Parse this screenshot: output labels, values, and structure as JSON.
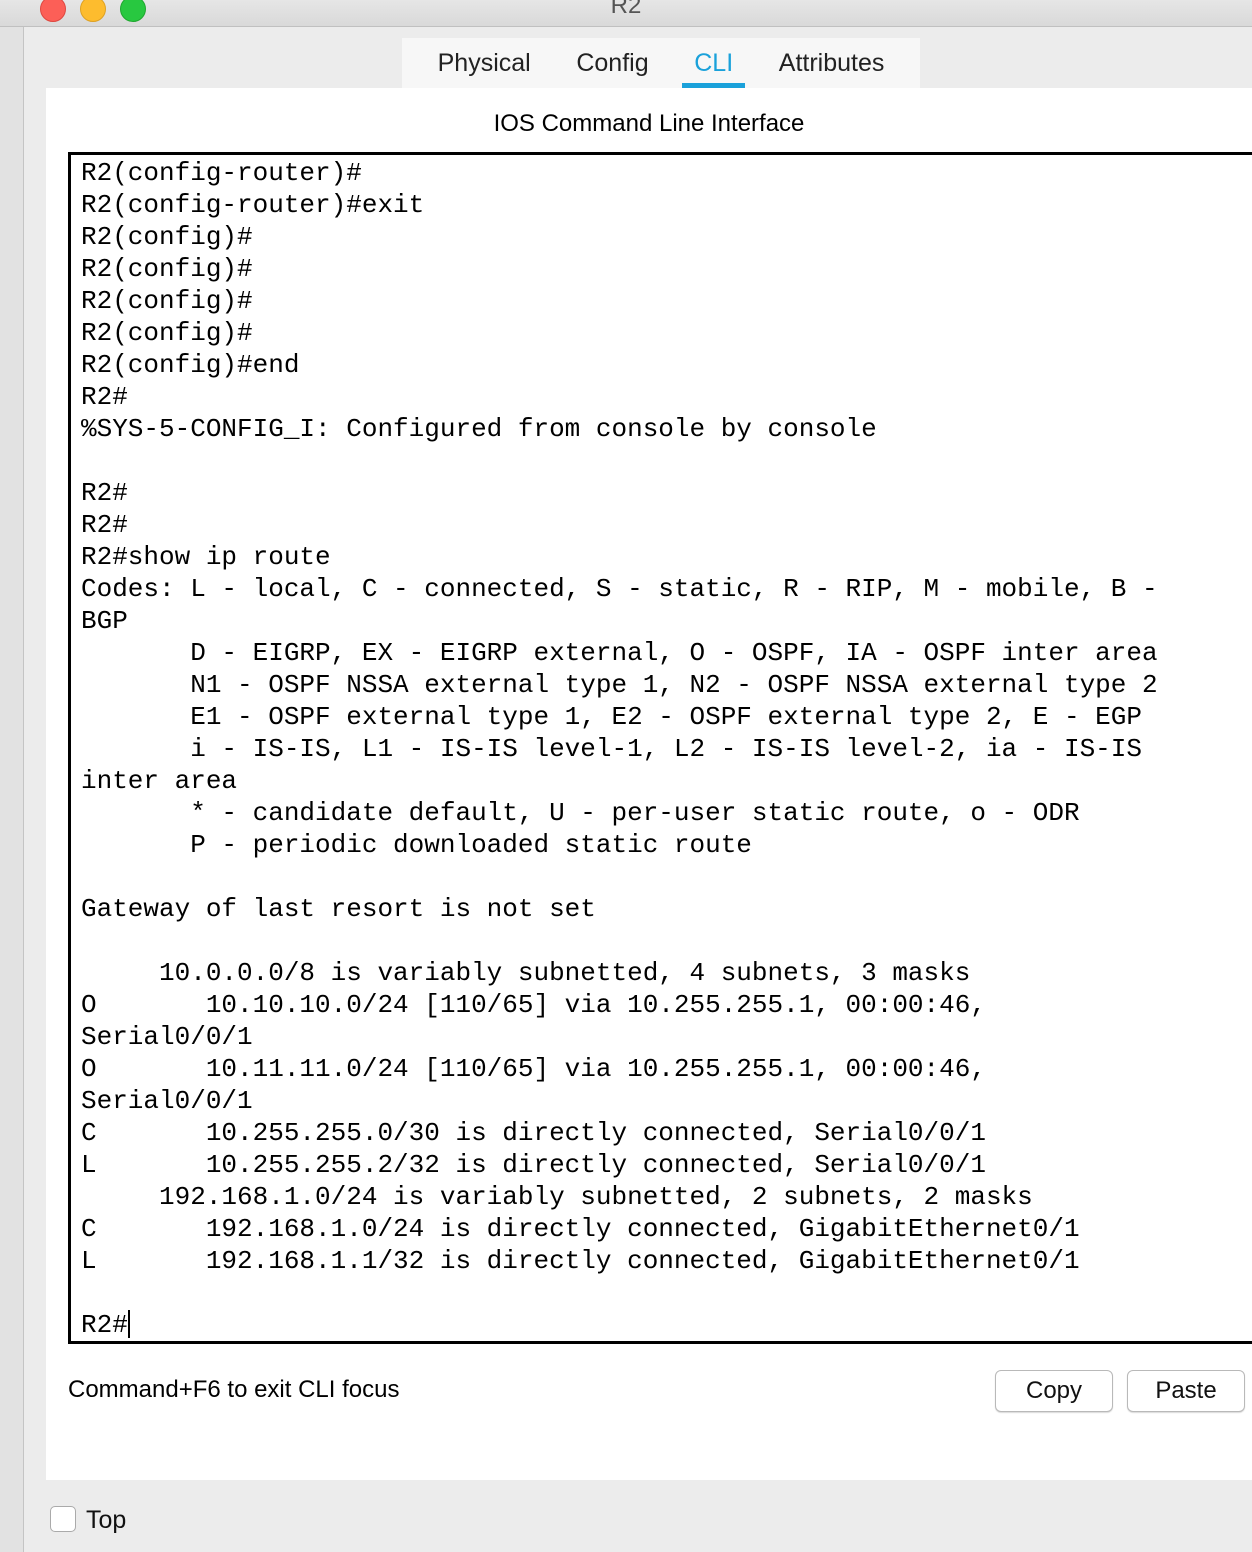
{
  "window": {
    "title": "R2"
  },
  "tabs": [
    {
      "label": "Physical",
      "active": false
    },
    {
      "label": "Config",
      "active": false
    },
    {
      "label": "CLI",
      "active": true
    },
    {
      "label": "Attributes",
      "active": false
    }
  ],
  "panel": {
    "title": "IOS Command Line Interface"
  },
  "terminal": {
    "lines": [
      "R2(config-router)#",
      "R2(config-router)#exit",
      "R2(config)#",
      "R2(config)#",
      "R2(config)#",
      "R2(config)#",
      "R2(config)#end",
      "R2#",
      "%SYS-5-CONFIG_I: Configured from console by console",
      "",
      "R2#",
      "R2#",
      "R2#show ip route",
      "Codes: L - local, C - connected, S - static, R - RIP, M - mobile, B -",
      "BGP",
      "       D - EIGRP, EX - EIGRP external, O - OSPF, IA - OSPF inter area",
      "       N1 - OSPF NSSA external type 1, N2 - OSPF NSSA external type 2",
      "       E1 - OSPF external type 1, E2 - OSPF external type 2, E - EGP",
      "       i - IS-IS, L1 - IS-IS level-1, L2 - IS-IS level-2, ia - IS-IS",
      "inter area",
      "       * - candidate default, U - per-user static route, o - ODR",
      "       P - periodic downloaded static route",
      "",
      "Gateway of last resort is not set",
      "",
      "     10.0.0.0/8 is variably subnetted, 4 subnets, 3 masks",
      "O       10.10.10.0/24 [110/65] via 10.255.255.1, 00:00:46,",
      "Serial0/0/1",
      "O       10.11.11.0/24 [110/65] via 10.255.255.1, 00:00:46,",
      "Serial0/0/1",
      "C       10.255.255.0/30 is directly connected, Serial0/0/1",
      "L       10.255.255.2/32 is directly connected, Serial0/0/1",
      "     192.168.1.0/24 is variably subnetted, 2 subnets, 2 masks",
      "C       192.168.1.0/24 is directly connected, GigabitEthernet0/1",
      "L       192.168.1.1/32 is directly connected, GigabitEthernet0/1",
      ""
    ],
    "prompt": "R2#"
  },
  "footer": {
    "hint": "Command+F6 to exit CLI focus",
    "copy_label": "Copy",
    "paste_label": "Paste"
  },
  "bottom": {
    "top_label": "Top",
    "top_checked": false
  },
  "colors": {
    "accent": "#1aa1da",
    "close": "#fc5f57",
    "minimize": "#fdbc2e",
    "maximize": "#28c840"
  }
}
